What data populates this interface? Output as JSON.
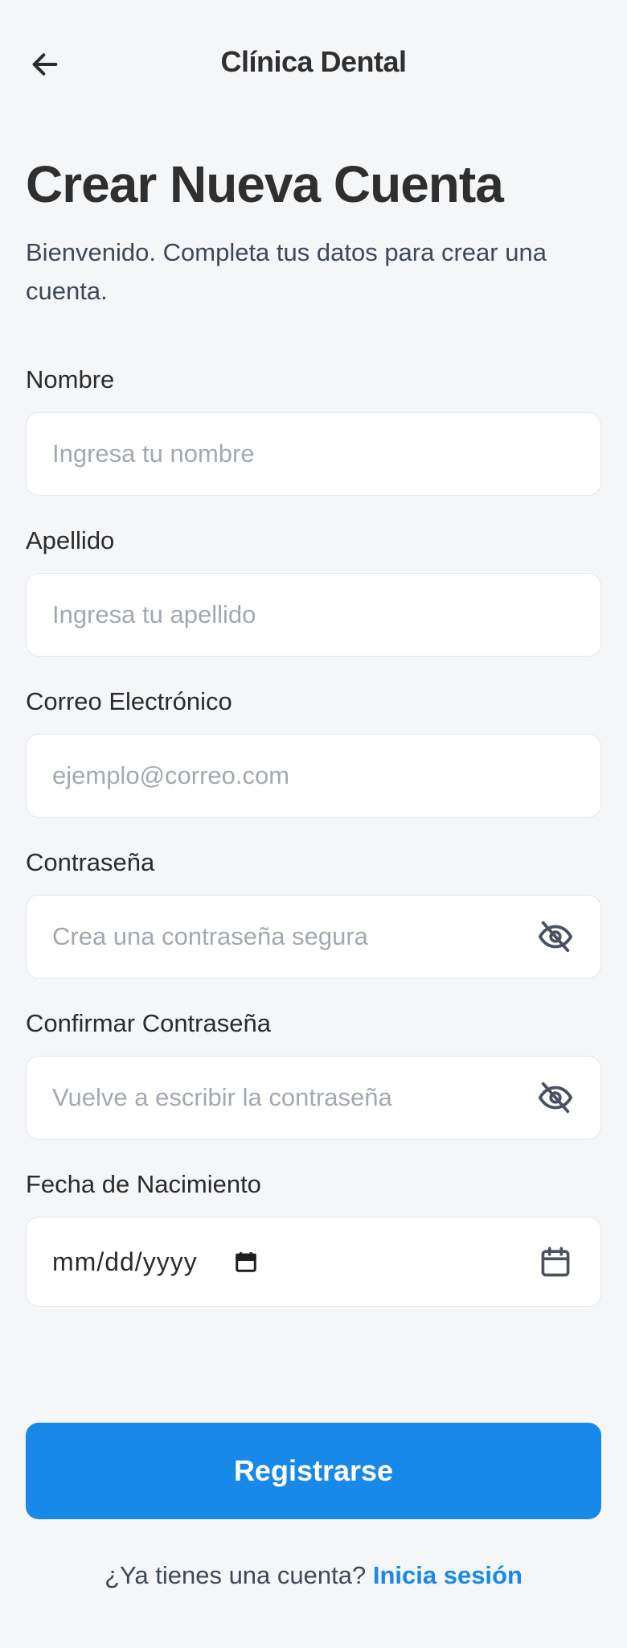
{
  "header": {
    "back_icon": "arrow-left-icon",
    "title": "Clínica Dental"
  },
  "page": {
    "title": "Crear Nueva Cuenta",
    "subtitle": "Bienvenido. Completa tus datos para crear una cuenta."
  },
  "form": {
    "first_name": {
      "label": "Nombre",
      "placeholder": "Ingresa tu nombre",
      "value": ""
    },
    "last_name": {
      "label": "Apellido",
      "placeholder": "Ingresa tu apellido",
      "value": ""
    },
    "email": {
      "label": "Correo Electrónico",
      "placeholder": "ejemplo@correo.com",
      "value": ""
    },
    "password": {
      "label": "Contraseña",
      "placeholder": "Crea una contraseña segura",
      "value": "",
      "toggle_icon": "eye-off-icon"
    },
    "confirm_password": {
      "label": "Confirmar Contraseña",
      "placeholder": "Vuelve a escribir la contraseña",
      "value": "",
      "toggle_icon": "eye-off-icon"
    },
    "birth_date": {
      "label": "Fecha de Nacimiento",
      "value": "mm/dd/yyyy",
      "picker_icon": "calendar-icon",
      "trailing_icon": "calendar-icon"
    }
  },
  "actions": {
    "submit_label": "Registrarse"
  },
  "footer": {
    "prompt": "¿Ya tienes una cuenta?",
    "link": "Inicia sesión"
  },
  "colors": {
    "background": "#f5f6f8",
    "primary": "#1889e8",
    "text": "#2b2b2b",
    "placeholder": "#a3a8b3"
  }
}
